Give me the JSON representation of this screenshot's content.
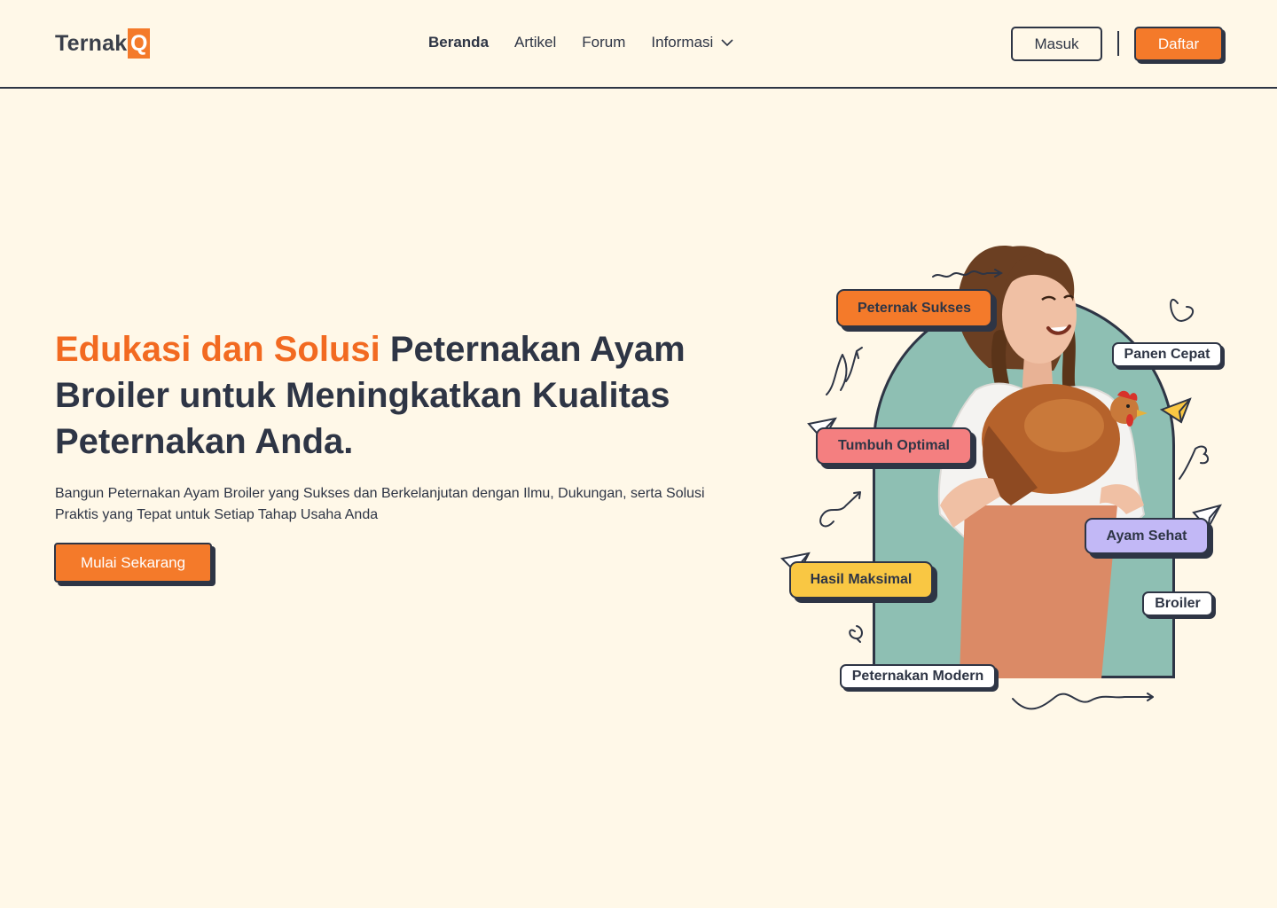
{
  "header": {
    "logo_text": "Ternak",
    "logo_mark": "Q",
    "nav": {
      "beranda": "Beranda",
      "artikel": "Artikel",
      "forum": "Forum",
      "informasi": "Informasi"
    },
    "login_label": "Masuk",
    "register_label": "Daftar"
  },
  "hero": {
    "title_accent": "Edukasi dan Solusi",
    "title_rest": " Peternakan Ayam Broiler untuk Meningkatkan Kualitas Peternakan Anda.",
    "subtitle": "Bangun Peternakan Ayam Broiler yang Sukses dan Berkelanjutan dengan Ilmu, Dukungan, serta Solusi Praktis yang Tepat untuk Setiap Tahap Usaha Anda",
    "cta_label": "Mulai Sekarang"
  },
  "illustration": {
    "tags": {
      "peternak_sukses": "Peternak Sukses",
      "panen_cepat": "Panen Cepat",
      "tumbuh_optimal": "Tumbuh Optimal",
      "ayam_sehat": "Ayam Sehat",
      "hasil_maksimal": "Hasil Maksimal",
      "broiler": "Broiler",
      "peternakan_modern": "Peternakan Modern"
    }
  },
  "colors": {
    "background": "#FFF8E8",
    "accent": "#F47A2A",
    "text": "#2E3545",
    "arch": "#8EBFB3"
  }
}
